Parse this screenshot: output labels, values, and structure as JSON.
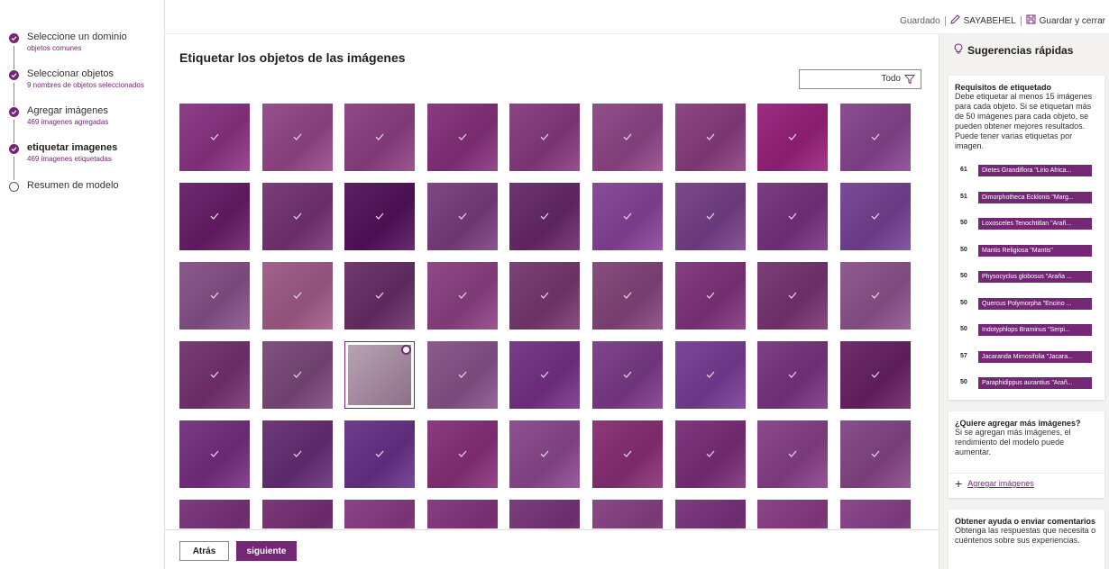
{
  "steps": [
    {
      "title": "Seleccione un dominio",
      "sub": "objetos comunes",
      "state": "done"
    },
    {
      "title": "Seleccionar objetos",
      "sub": "9 nombres de objetos seleccionados",
      "state": "done"
    },
    {
      "title": "Agregar imágenes",
      "sub": "469 imagenes agregadas",
      "state": "done"
    },
    {
      "title": "etiquetar imagenes",
      "sub": "469 imagenes etiquetadas",
      "state": "current"
    },
    {
      "title": "Resumen de modelo",
      "sub": "",
      "state": "pending"
    }
  ],
  "topbar": {
    "status": "Guardado",
    "model_name": "SAYABEHEL",
    "save_close": "Guardar y cerrar"
  },
  "main": {
    "title": "Etiquetar los objetos de las imágenes",
    "filter_value": "Todo",
    "back_label": "Atrás",
    "next_label": "siguiente"
  },
  "rightpanel": {
    "header": "Sugerencias rápidas",
    "requirements": {
      "title": "Requisitos de etiquetado",
      "body": "Debe etiquetar al menos 15 imágenes para cada objeto. Si se etiquetan más de 50 imágenes para cada objeto, se pueden obtener mejores resultados. Puede tener varias etiquetas por imagen.",
      "items": [
        {
          "count": "61",
          "tag": "Dietes Grandiflora \"Lirio Africa..."
        },
        {
          "count": "51",
          "tag": "Dimorphotheca Ecklonis \"Marg..."
        },
        {
          "count": "50",
          "tag": "Loxosceles Tenochtitlan \"Arañ..."
        },
        {
          "count": "50",
          "tag": "Mantis Religiosa \"Mantis\""
        },
        {
          "count": "50",
          "tag": "Physocyclus globosus \"Araña ..."
        },
        {
          "count": "50",
          "tag": "Quercus Polymorpha \"Encino ..."
        },
        {
          "count": "50",
          "tag": "Indotyphlops Braminus \"Serpi..."
        },
        {
          "count": "57",
          "tag": "Jacaranda Mimosifolia \"Jacara..."
        },
        {
          "count": "50",
          "tag": "Paraphidippus aurantius \"Arañ..."
        }
      ]
    },
    "more": {
      "title": "¿Quiere agregar más imágenes?",
      "body": "Si se agregan más imágenes, el rendimiento del modelo puede aumentar.",
      "link": "Agregar imágenes"
    },
    "help": {
      "title": "Obtener ayuda o enviar comentarios",
      "body": "Obtenga las respuestas que necesita o cuéntenos sobre sus experiencias."
    }
  },
  "colors": {
    "accent": "#742774"
  },
  "grid": {
    "rows": 6,
    "cols": 9,
    "selected_index": 29,
    "tiles": [
      "#8e3f86",
      "#96508c",
      "#8f4a87",
      "#8a3c80",
      "#8b4585",
      "#91508b",
      "#8c4883",
      "#9a2e7f",
      "#8a4f91",
      "#6e2b6e",
      "#7a3f7b",
      "#5c2163",
      "#7e4883",
      "#6d3670",
      "#8a4d99",
      "#7a4a8a",
      "#7d3d82",
      "#7b4c96",
      "#8a5a8c",
      "#a1628b",
      "#6f3b6f",
      "#8f4a88",
      "#7b4376",
      "#874f80",
      "#833f80",
      "#7c3f78",
      "#905c8f",
      "#7b3d76",
      "#80527f",
      "#ffffff",
      "#8b5b8d",
      "#7a3d8a",
      "#80468c",
      "#7d4797",
      "#7f3f84",
      "#6e2f6c",
      "#7a3b84",
      "#6d3a7a",
      "#6e3e8c",
      "#8a3c7e",
      "#8e5292",
      "#8d3a7a",
      "#7f3a7e",
      "#8a4a8c",
      "#88508a",
      "#7e3d7f",
      "#7b3a79",
      "#8b4586",
      "#864082",
      "#7c3f7e",
      "#8a4a88",
      "#7d3d80",
      "#8c4587",
      "#8a4a8b"
    ]
  }
}
